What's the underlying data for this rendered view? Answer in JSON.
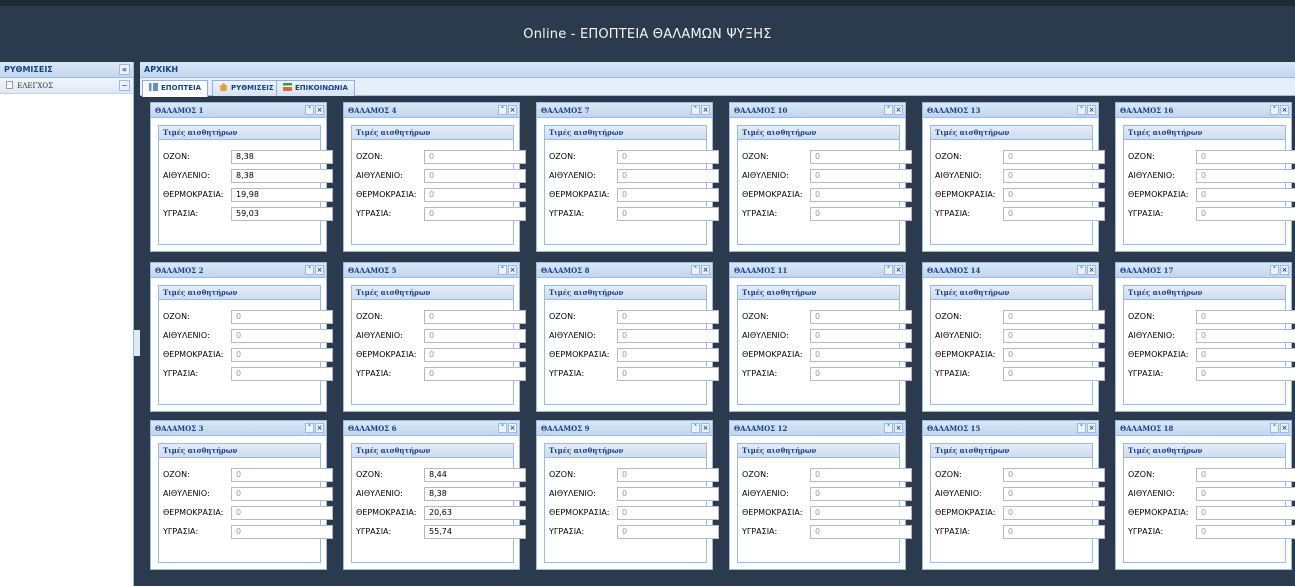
{
  "app": {
    "title": "Online - ΕΠΟΠΤΕΙΑ ΘΑΛΑΜΩΝ ΨΥΞΗΣ"
  },
  "left_panel": {
    "title": "ΡΥΘΜΙΣΕΙΣ",
    "item": "ΕΛΕΓΧΟΣ"
  },
  "main": {
    "title": "ΑΡΧΙΚΗ",
    "tabs": [
      "ΕΠΟΠΤΕΙΑ",
      "ΡΥΘΜΙΣΕΙΣ",
      "ΕΠΙΚΟΙΝΩΝΙΑ"
    ]
  },
  "field_labels": {
    "ozone": "ΟΖΟΝ:",
    "ethylene": "ΑΙΘΥΛΕΝΙΟ:",
    "temperature": "ΘΕΡΜΟΚΡΑΣΙΑ:",
    "humidity": "ΥΓΡΑΣΙΑ:"
  },
  "fieldset_title": "Τιμές αισθητήρων",
  "chambers": [
    {
      "name": "ΘΑΛΑΜΟΣ 1",
      "ozone": "8,38",
      "ethylene": "8,38",
      "temperature": "19,98",
      "humidity": "59,03"
    },
    {
      "name": "ΘΑΛΑΜΟΣ 2",
      "ozone": "0",
      "ethylene": "0",
      "temperature": "0",
      "humidity": "0"
    },
    {
      "name": "ΘΑΛΑΜΟΣ 3",
      "ozone": "0",
      "ethylene": "0",
      "temperature": "0",
      "humidity": "0"
    },
    {
      "name": "ΘΑΛΑΜΟΣ 4",
      "ozone": "0",
      "ethylene": "0",
      "temperature": "0",
      "humidity": "0"
    },
    {
      "name": "ΘΑΛΑΜΟΣ 5",
      "ozone": "0",
      "ethylene": "0",
      "temperature": "0",
      "humidity": "0"
    },
    {
      "name": "ΘΑΛΑΜΟΣ 6",
      "ozone": "8,44",
      "ethylene": "8,38",
      "temperature": "20,63",
      "humidity": "55,74"
    },
    {
      "name": "ΘΑΛΑΜΟΣ 7",
      "ozone": "0",
      "ethylene": "0",
      "temperature": "0",
      "humidity": "0"
    },
    {
      "name": "ΘΑΛΑΜΟΣ 8",
      "ozone": "0",
      "ethylene": "0",
      "temperature": "0",
      "humidity": "0"
    },
    {
      "name": "ΘΑΛΑΜΟΣ 9",
      "ozone": "0",
      "ethylene": "0",
      "temperature": "0",
      "humidity": "0"
    },
    {
      "name": "ΘΑΛΑΜΟΣ 10",
      "ozone": "0",
      "ethylene": "0",
      "temperature": "0",
      "humidity": "0"
    },
    {
      "name": "ΘΑΛΑΜΟΣ 11",
      "ozone": "0",
      "ethylene": "0",
      "temperature": "0",
      "humidity": "0"
    },
    {
      "name": "ΘΑΛΑΜΟΣ 12",
      "ozone": "0",
      "ethylene": "0",
      "temperature": "0",
      "humidity": "0"
    },
    {
      "name": "ΘΑΛΑΜΟΣ 13",
      "ozone": "0",
      "ethylene": "0",
      "temperature": "0",
      "humidity": "0"
    },
    {
      "name": "ΘΑΛΑΜΟΣ 14",
      "ozone": "0",
      "ethylene": "0",
      "temperature": "0",
      "humidity": "0"
    },
    {
      "name": "ΘΑΛΑΜΟΣ 15",
      "ozone": "0",
      "ethylene": "0",
      "temperature": "0",
      "humidity": "0"
    },
    {
      "name": "ΘΑΛΑΜΟΣ 16",
      "ozone": "0",
      "ethylene": "0",
      "temperature": "0",
      "humidity": "0"
    },
    {
      "name": "ΘΑΛΑΜΟΣ 17",
      "ozone": "0",
      "ethylene": "0",
      "temperature": "0",
      "humidity": "0"
    },
    {
      "name": "ΘΑΛΑΜΟΣ 18",
      "ozone": "0",
      "ethylene": "0",
      "temperature": "0",
      "humidity": "0"
    }
  ],
  "colors": {
    "header_bg": "#2b3b4d",
    "panel_title": "#15428b",
    "border": "#99bbe8"
  }
}
